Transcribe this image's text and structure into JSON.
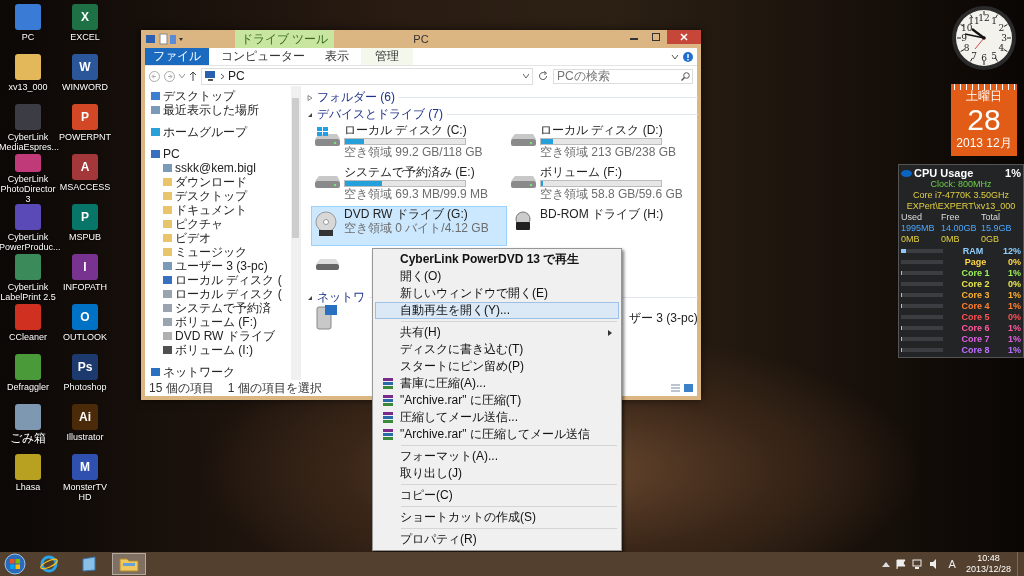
{
  "desktop_icons": [
    {
      "label": "PC",
      "color": "#3a7bd5"
    },
    {
      "label": "EXCEL",
      "color": "#1e7145",
      "glyph": "X"
    },
    {
      "label": "xv13_000",
      "color": "#e2b85a"
    },
    {
      "label": "WINWORD",
      "color": "#2b579a",
      "glyph": "W"
    },
    {
      "label": "CyberLink MediaEspres...",
      "color": "#3c3c44"
    },
    {
      "label": "POWERPNT",
      "color": "#d24726",
      "glyph": "P"
    },
    {
      "label": "CyberLink PhotoDirector 3",
      "color": "#c03a7a"
    },
    {
      "label": "MSACCESS",
      "color": "#a4373a",
      "glyph": "A"
    },
    {
      "label": "CyberLink PowerProduc...",
      "color": "#5a4ab8"
    },
    {
      "label": "MSPUB",
      "color": "#077568",
      "glyph": "P"
    },
    {
      "label": "CyberLink LabelPrint 2.5",
      "color": "#3a8a5a"
    },
    {
      "label": "INFOPATH",
      "color": "#77338f",
      "glyph": "I"
    },
    {
      "label": "CCleaner",
      "color": "#d03020"
    },
    {
      "label": "OUTLOOK",
      "color": "#0072c6",
      "glyph": "O"
    },
    {
      "label": "Defraggler",
      "color": "#4a9a3a"
    },
    {
      "label": "Photoshop",
      "color": "#1c3a6e",
      "glyph": "Ps"
    },
    {
      "label": "ごみ箱",
      "color": "#7f98b2"
    },
    {
      "label": "Illustrator",
      "color": "#4a2a08",
      "glyph": "Ai"
    },
    {
      "label": "Lhasa",
      "color": "#b8a020"
    },
    {
      "label": "MonsterTV HD",
      "color": "#3050b0",
      "glyph": "M"
    }
  ],
  "explorer": {
    "title": "PC",
    "contextual_tab": "ドライブ ツール",
    "tabs": [
      {
        "label": "ファイル",
        "kind": "file"
      },
      {
        "label": "コンピューター",
        "kind": "normal"
      },
      {
        "label": "表示",
        "kind": "normal"
      },
      {
        "label": "管理",
        "kind": "contextual"
      }
    ],
    "address": {
      "path": "PC"
    },
    "search": {
      "placeholder": "PCの検索"
    },
    "nav_sections": [
      {
        "items": [
          {
            "label": "デスクトップ",
            "kind": "desktop"
          },
          {
            "label": "最近表示した場所",
            "kind": "recent"
          }
        ]
      },
      {
        "items": [
          {
            "label": "ホームグループ",
            "kind": "homegroup"
          }
        ]
      },
      {
        "items": [
          {
            "label": "PC",
            "kind": "pc",
            "children": [
              {
                "label": "sskk@kem.bigl",
                "kind": "user"
              },
              {
                "label": "ダウンロード",
                "kind": "folder"
              },
              {
                "label": "デスクトップ",
                "kind": "folder"
              },
              {
                "label": "ドキュメント",
                "kind": "folder"
              },
              {
                "label": "ピクチャ",
                "kind": "folder"
              },
              {
                "label": "ビデオ",
                "kind": "folder"
              },
              {
                "label": "ミュージック",
                "kind": "folder"
              },
              {
                "label": "ユーザー 3 (3-pc)",
                "kind": "user"
              },
              {
                "label": "ローカル ディスク (",
                "kind": "pc"
              },
              {
                "label": "ローカル ディスク (",
                "kind": "disk"
              },
              {
                "label": "システムで予約済",
                "kind": "disk"
              },
              {
                "label": "ボリューム (F:)",
                "kind": "disk"
              },
              {
                "label": "DVD RW ドライブ",
                "kind": "dvd"
              },
              {
                "label": "ボリューム (I:)",
                "kind": "volume"
              }
            ]
          }
        ]
      },
      {
        "items": [
          {
            "label": "ネットワーク",
            "kind": "network"
          }
        ]
      }
    ],
    "groups": [
      {
        "label": "フォルダー (6)",
        "expanded": false
      },
      {
        "label": "デバイスとドライブ (7)",
        "expanded": true,
        "drives": [
          {
            "name": "ローカル ディスク (C:)",
            "free": "空き領域 99.2 GB/118 GB",
            "level": 0.16,
            "kind": "system",
            "selected": false
          },
          {
            "name": "ローカル ディスク (D:)",
            "free": "空き領域 213 GB/238 GB",
            "level": 0.1,
            "kind": "disk",
            "selected": false
          },
          {
            "name": "システムで予約済み (E:)",
            "free": "空き領域 69.3 MB/99.9 MB",
            "level": 0.31,
            "kind": "disk",
            "selected": false
          },
          {
            "name": "ボリューム (F:)",
            "free": "空き領域 58.8 GB/59.6 GB",
            "level": 0.02,
            "kind": "disk",
            "selected": false
          },
          {
            "name": "DVD RW ドライブ (G:)",
            "free": "空き領域 0 バイト/4.12 GB",
            "kind": "optical",
            "selected": true
          },
          {
            "name": "BD-ROM ドライブ (H:)",
            "kind": "bd",
            "selected": false
          },
          {
            "kind": "removable",
            "selected": false
          }
        ]
      },
      {
        "label": "ネットワ",
        "expanded": true,
        "network_items": [
          {
            "label": "ザー 3 (3-pc)"
          }
        ]
      }
    ],
    "status": {
      "count": "15 個の項目",
      "selection": "1 個の項目を選択"
    }
  },
  "context_menu": [
    {
      "label": "CyberLink PowerDVD 13 で再生",
      "kind": "default",
      "selected": false,
      "submenu": false
    },
    {
      "label": "開く(O)",
      "kind": "item",
      "selected": false,
      "submenu": false
    },
    {
      "label": "新しいウィンドウで開く(E)",
      "kind": "item",
      "selected": false,
      "submenu": false
    },
    {
      "label": "自動再生を開く(Y)...",
      "kind": "item",
      "selected": true,
      "submenu": false
    },
    {
      "kind": "separator"
    },
    {
      "label": "共有(H)",
      "kind": "item",
      "selected": false,
      "submenu": true
    },
    {
      "label": "ディスクに書き込む(T)",
      "kind": "item",
      "selected": false,
      "submenu": false
    },
    {
      "label": "スタートにピン留め(P)",
      "kind": "item",
      "selected": false,
      "submenu": false
    },
    {
      "label": "書庫に圧縮(A)...",
      "kind": "archive",
      "selected": false,
      "submenu": false
    },
    {
      "label": "\"Archive.rar\" に圧縮(T)",
      "kind": "archive",
      "selected": false,
      "submenu": false
    },
    {
      "label": "圧縮してメール送信...",
      "kind": "archive",
      "selected": false,
      "submenu": false
    },
    {
      "label": "\"Archive.rar\" に圧縮してメール送信",
      "kind": "archive",
      "selected": false,
      "submenu": false
    },
    {
      "kind": "separator"
    },
    {
      "label": "フォーマット(A)...",
      "kind": "item",
      "selected": false,
      "submenu": false
    },
    {
      "label": "取り出し(J)",
      "kind": "item",
      "selected": false,
      "submenu": false
    },
    {
      "kind": "separator"
    },
    {
      "label": "コピー(C)",
      "kind": "item",
      "selected": false,
      "submenu": false
    },
    {
      "kind": "separator"
    },
    {
      "label": "ショートカットの作成(S)",
      "kind": "item",
      "selected": false,
      "submenu": false
    },
    {
      "kind": "separator"
    },
    {
      "label": "プロパティ(R)",
      "kind": "item",
      "selected": false,
      "submenu": false
    }
  ],
  "clock": {
    "numerals": [
      "12",
      "11",
      "1",
      "10",
      "2",
      "9",
      "3",
      "8",
      "4",
      "7",
      "6",
      "5"
    ]
  },
  "calendar": {
    "weekday": "土曜日",
    "day": "28",
    "month": "2013 12月"
  },
  "cpu_gadget": {
    "title": "CPU Usage",
    "percent": "1%",
    "clock": "Clock: 800MHz",
    "model": "Core i7-4770K 3.50GHz",
    "user": "EXPert\\EXPERT\\xv13_000",
    "headers": [
      "Used",
      "Free",
      "Total"
    ],
    "memory_rows": [
      [
        "1995MB",
        "14.00GB",
        "15.9GB"
      ],
      [
        "0MB",
        "0MB",
        "0GB"
      ]
    ],
    "meters": [
      {
        "label": "RAM",
        "value": "12%",
        "level": 0.12,
        "color": "#8fd0ff"
      },
      {
        "label": "Page",
        "value": "0%",
        "level": 0,
        "color": "#ffd84a"
      },
      {
        "label": "Core 1",
        "value": "1%",
        "level": 0.01,
        "color": "#9ef05a"
      },
      {
        "label": "Core 2",
        "value": "0%",
        "level": 0,
        "color": "#e8e84a"
      },
      {
        "label": "Core 3",
        "value": "1%",
        "level": 0.01,
        "color": "#ffb030"
      },
      {
        "label": "Core 4",
        "value": "1%",
        "level": 0.01,
        "color": "#ff8030"
      },
      {
        "label": "Core 5",
        "value": "0%",
        "level": 0,
        "color": "#ff5050"
      },
      {
        "label": "Core 6",
        "value": "1%",
        "level": 0.01,
        "color": "#ff5a9a"
      },
      {
        "label": "Core 7",
        "value": "1%",
        "level": 0.01,
        "color": "#e060e0"
      },
      {
        "label": "Core 8",
        "value": "1%",
        "level": 0.01,
        "color": "#c070ff"
      }
    ]
  },
  "taskbar": {
    "buttons": [
      {
        "kind": "ie",
        "active": false
      },
      {
        "kind": "app",
        "active": false
      },
      {
        "kind": "explorer",
        "active": true
      }
    ],
    "ime": "A",
    "time": "10:48",
    "date": "2013/12/28"
  }
}
